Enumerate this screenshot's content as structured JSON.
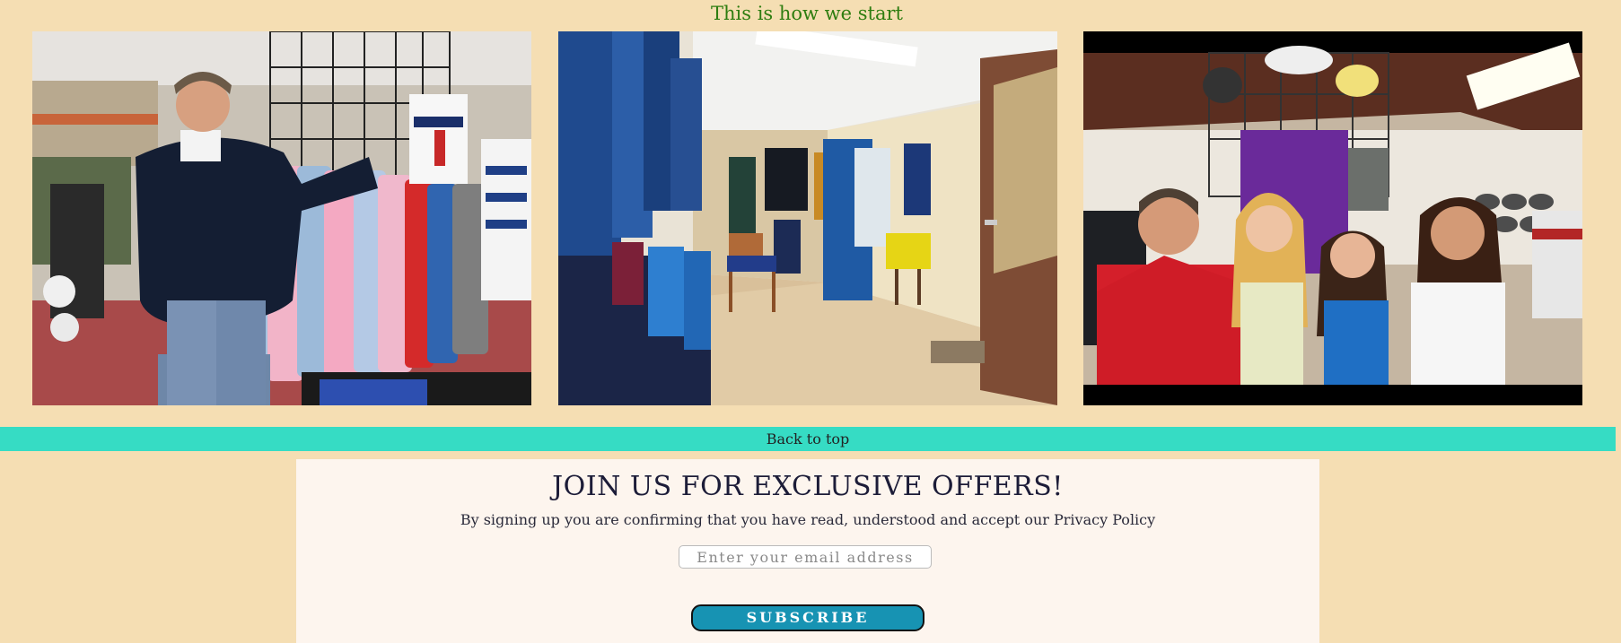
{
  "gallery": {
    "heading": "This is how we start",
    "photos": [
      {
        "subject": "Man in navy rugby jersey standing beside rack of colourful rugby tops in a sports store"
      },
      {
        "subject": "Interior of a rugby clothing shop with jackets on wall racks, chairs and a doorway"
      },
      {
        "subject": "Four people smiling in a rugby store with merchandise hanging behind them"
      }
    ]
  },
  "nav": {
    "back_to_top_label": "Back to top"
  },
  "newsletter": {
    "title": "JOIN US FOR EXCLUSIVE OFFERS!",
    "description": "By signing up you are confirming that you have read, understood and accept our Privacy Policy",
    "email_placeholder": "Enter your email address",
    "email_value": "",
    "subscribe_label": "SUBSCRIBE"
  },
  "colors": {
    "page_background": "#f5deb3",
    "heading_green": "#2e7d10",
    "back_to_top_bar": "#36dcc4",
    "newsletter_panel": "#fdf5ee",
    "subscribe_button": "#1793b3"
  }
}
